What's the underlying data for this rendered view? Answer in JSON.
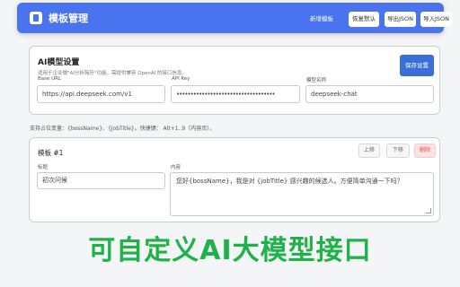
{
  "header": {
    "title": "模板管理",
    "nav_link": "新增模板",
    "buttons": [
      "恢复默认",
      "导出JSON",
      "导入JSON"
    ],
    "accent_color": "#4a73f0"
  },
  "ai_settings": {
    "title": "AI模型设置",
    "subtitle": "适用于企业微\"AI分析简历\"功能。需提供兼容 OpenAI 的接口信息。",
    "save_label": "保存设置",
    "fields": {
      "base_url": {
        "label": "Base URL",
        "value": "https://api.deepseek.com/v1"
      },
      "api_key": {
        "label": "API Key",
        "value": "•••••••••••••••••••••••••••••••••••"
      },
      "model": {
        "label": "模型名称",
        "value": "deepseek-chat"
      }
    }
  },
  "hint": "支持占位变量：{bossName}、{jobTitle}。快捷键： Alt+1..9（内容页）。",
  "template": {
    "title": "模板 #1",
    "buttons": {
      "up": "上移",
      "down": "下移",
      "delete": "删除"
    },
    "title_label": "标题",
    "title_value": "初次问候",
    "content_label": "内容",
    "content_value": "您好{bossName}，我是对 {jobTitle} 感兴趣的候选人。方便简单沟通一下吗？"
  },
  "banner": {
    "text": "可自定义AI大模型接口",
    "color": "#1fb24a"
  }
}
